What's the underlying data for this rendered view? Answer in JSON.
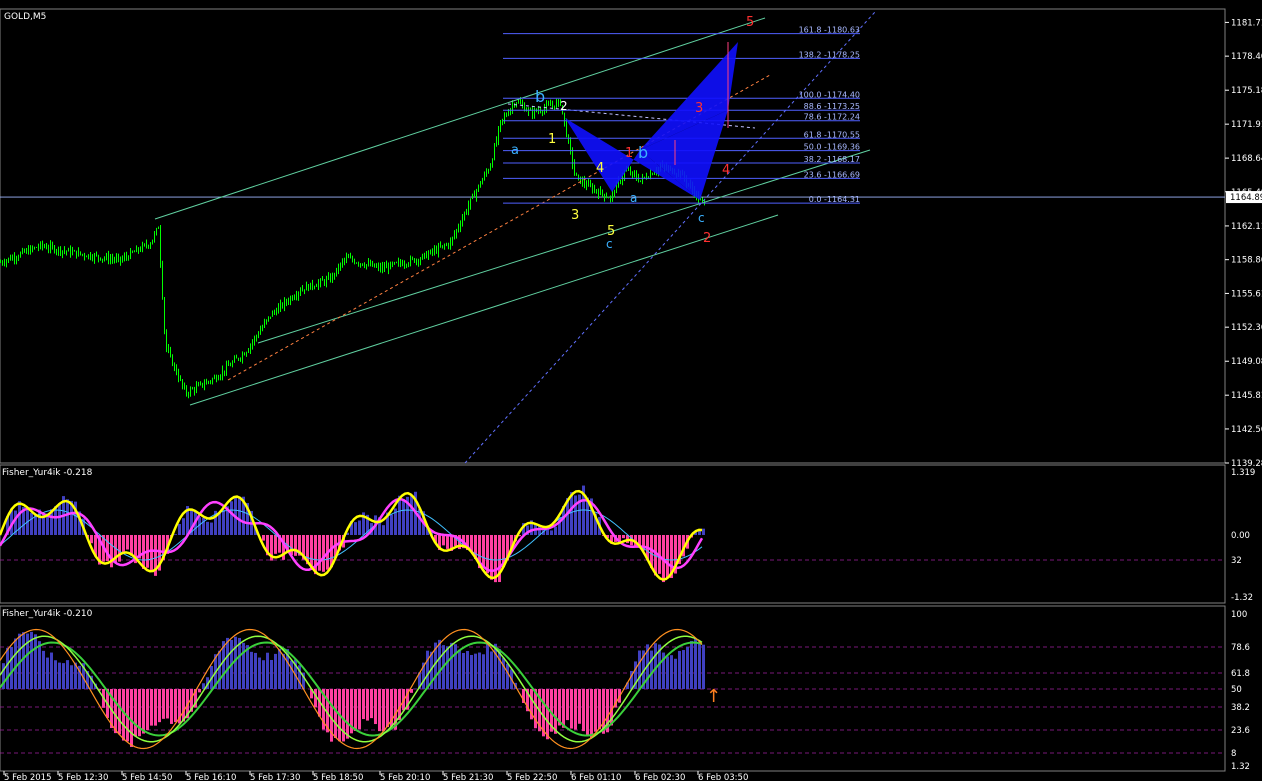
{
  "window": {
    "symbol_label": "GOLD,M5"
  },
  "chart_data": [
    {
      "type": "candlestick",
      "title": "GOLD,M5",
      "ylim": [
        1139.28,
        1183.0
      ],
      "yticks": [
        1181.71,
        1178.46,
        1175.18,
        1171.91,
        1168.64,
        1165.4,
        1162.11,
        1158.86,
        1155.61,
        1152.36,
        1149.08,
        1145.81,
        1142.56,
        1139.28
      ],
      "current_price": 1164.89,
      "fibonacci": [
        {
          "level": "161.8",
          "price": "1180.63"
        },
        {
          "level": "138.2",
          "price": "1178.25"
        },
        {
          "level": "100.0",
          "price": "1174.40"
        },
        {
          "level": "88.6",
          "price": "1173.25"
        },
        {
          "level": "78.6",
          "price": "1172.24"
        },
        {
          "level": "61.8",
          "price": "1170.55"
        },
        {
          "level": "50.0",
          "price": "1169.36"
        },
        {
          "level": "38.2",
          "price": "1168.17"
        },
        {
          "level": "23.6",
          "price": "1166.69"
        },
        {
          "level": "0.0",
          "price": "1164.31"
        }
      ],
      "wave_labels": [
        "b",
        "2",
        "1",
        "a",
        "3",
        "4",
        "5",
        "c",
        "1",
        "b",
        "a",
        "3",
        "4",
        "5",
        "c",
        "2"
      ],
      "grid": false
    },
    {
      "type": "bar",
      "title": "Fisher_Yur4ik -0.218",
      "ylim": [
        -1.32,
        1.319
      ],
      "yticks": [
        "1.319",
        "0.00",
        "32",
        "-1.32"
      ]
    },
    {
      "type": "bar",
      "title": "Fisher_Yur4ik -0.210",
      "ylim": [
        1.32,
        100
      ],
      "yticks": [
        "100",
        "78.6",
        "61.8",
        "50",
        "38.2",
        "23.6",
        "8",
        "1.32"
      ]
    }
  ],
  "time_axis": [
    "5 Feb 2015",
    "5 Feb 12:30",
    "5 Feb 14:50",
    "5 Feb 16:10",
    "5 Feb 17:30",
    "5 Feb 18:50",
    "5 Feb 20:10",
    "5 Feb 21:30",
    "5 Feb 22:50",
    "6 Feb 01:10",
    "6 Feb 02:30",
    "6 Feb 03:50"
  ],
  "colors": {
    "candle": "#00ff00",
    "channel": "#60d0a0",
    "fib": "#5060ff",
    "pattern": "#1010ff",
    "fisher_pos": "#4040c0",
    "fisher_neg": "#ff40a0",
    "fisher_line": "#ffff00",
    "fisher_signal": "#ff40ff"
  }
}
